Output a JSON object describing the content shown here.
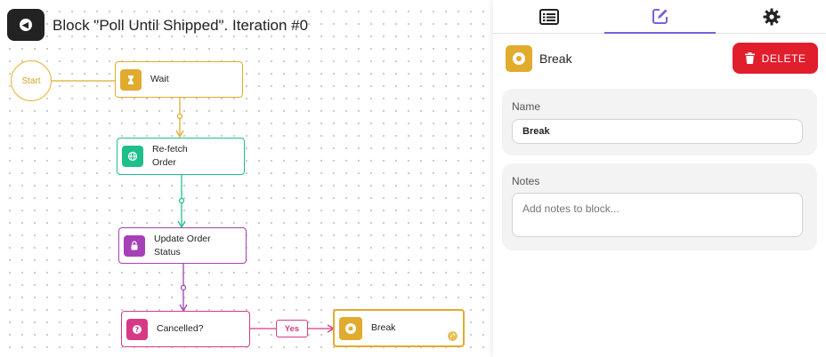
{
  "canvas": {
    "title": "Block \"Poll Until Shipped\". Iteration #0",
    "back_icon": "back-arrow-icon",
    "start_label": "Start",
    "nodes": [
      {
        "id": "wait",
        "label": "Wait",
        "icon": "hourglass-icon",
        "color": "#e1ab2e"
      },
      {
        "id": "refetch",
        "label": "Re-fetch Order",
        "label_line1": "Re-fetch",
        "label_line2": "Order",
        "icon": "globe-icon",
        "color": "#1dbf8a"
      },
      {
        "id": "update",
        "label": "Update Order Status",
        "label_line1": "Update Order",
        "label_line2": "Status",
        "icon": "bag-icon",
        "color": "#a540b7"
      },
      {
        "id": "cancelled",
        "label": "Cancelled?",
        "icon": "question-icon",
        "color": "#d63a87"
      },
      {
        "id": "break",
        "label": "Break",
        "icon": "stop-circle-icon",
        "color": "#e1ab2e"
      }
    ],
    "yes_label": "Yes"
  },
  "panel": {
    "tabs": [
      {
        "id": "list",
        "icon": "list-icon",
        "active": false
      },
      {
        "id": "edit",
        "icon": "edit-icon",
        "active": true
      },
      {
        "id": "settings",
        "icon": "gear-icon",
        "active": false
      }
    ],
    "block_name": "Break",
    "block_icon": "stop-circle-icon",
    "delete_label": "DELETE",
    "name_field": {
      "label": "Name",
      "value": "Break"
    },
    "notes_field": {
      "label": "Notes",
      "placeholder": "Add notes to block..."
    }
  },
  "colors": {
    "yellow": "#e1ab2e",
    "green": "#1dbf8a",
    "purple": "#a540b7",
    "pink": "#d63a87",
    "accent": "#7b61d9",
    "danger": "#e01e2c"
  }
}
